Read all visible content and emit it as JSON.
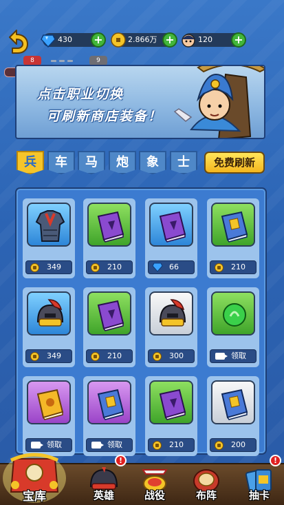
{
  "resources": [
    {
      "name": "gem",
      "value": "430"
    },
    {
      "name": "coin",
      "value": "2.866万"
    },
    {
      "name": "stamina",
      "value": "120"
    }
  ],
  "stage": {
    "left": "8",
    "right": "9"
  },
  "banner": {
    "line1": "点击职业切换",
    "line2": "可刷新商店装备！"
  },
  "tabs": [
    "兵",
    "车",
    "马",
    "炮",
    "象",
    "士"
  ],
  "active_tab": 0,
  "refresh_label": "免费刷新",
  "shop_items": [
    {
      "icon": "armor-icon",
      "bg": "blue",
      "currency": "coin",
      "price": "349"
    },
    {
      "icon": "purple-book-icon",
      "bg": "green",
      "currency": "coin",
      "price": "210"
    },
    {
      "icon": "purple-book-icon",
      "bg": "blue",
      "currency": "gem",
      "price": "66"
    },
    {
      "icon": "blue-book-icon",
      "bg": "green",
      "currency": "coin",
      "price": "210"
    },
    {
      "icon": "helmet-icon",
      "bg": "blue",
      "currency": "coin",
      "price": "349"
    },
    {
      "icon": "purple-book-icon",
      "bg": "green",
      "currency": "coin",
      "price": "210"
    },
    {
      "icon": "helmet-icon",
      "bg": "white",
      "currency": "coin",
      "price": "300"
    },
    {
      "icon": "green-orb-icon",
      "bg": "green",
      "currency": "video",
      "price": "领取"
    },
    {
      "icon": "gold-book-icon",
      "bg": "purple",
      "currency": "video",
      "price": "领取"
    },
    {
      "icon": "blue-book-icon",
      "bg": "purple",
      "currency": "video",
      "price": "领取"
    },
    {
      "icon": "purple-book-icon",
      "bg": "green",
      "currency": "coin",
      "price": "210"
    },
    {
      "icon": "blue-book-icon",
      "bg": "white",
      "currency": "coin",
      "price": "200"
    }
  ],
  "nav": [
    {
      "label": "宝库",
      "icon": "treasure-chest-icon",
      "selected": true,
      "badge": false
    },
    {
      "label": "英雄",
      "icon": "hero-helmet-icon",
      "selected": false,
      "badge": true
    },
    {
      "label": "战役",
      "icon": "battle-drum-icon",
      "selected": false,
      "badge": false
    },
    {
      "label": "布阵",
      "icon": "war-drum-icon",
      "selected": false,
      "badge": false
    },
    {
      "label": "抽卡",
      "icon": "card-draw-icon",
      "selected": false,
      "badge": true
    }
  ],
  "badge_text": "!",
  "colors": {
    "accent": "#f6c52a",
    "panel": "#3c7bd0",
    "price_bg": "#2a4c86"
  }
}
